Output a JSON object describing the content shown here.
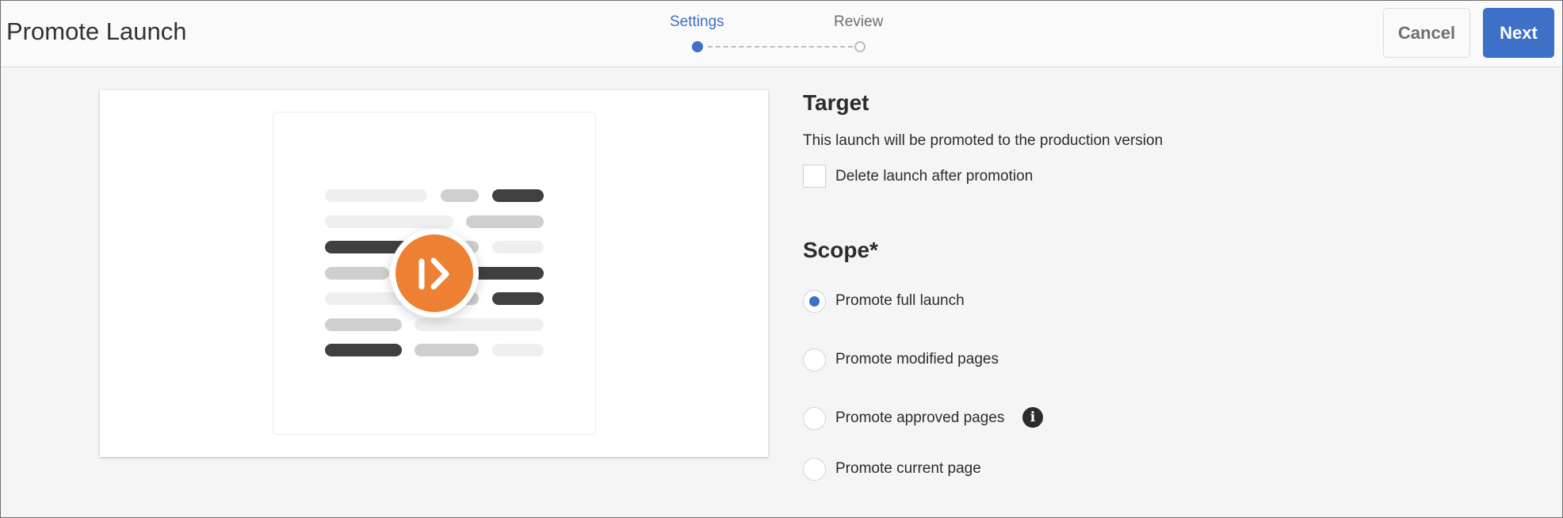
{
  "header": {
    "title": "Promote Launch",
    "steps": [
      {
        "label": "Settings",
        "state": "active"
      },
      {
        "label": "Review",
        "state": "pending"
      }
    ],
    "cancel_label": "Cancel",
    "next_label": "Next"
  },
  "colors": {
    "accent": "#3d70c6",
    "badge": "#ee8033"
  },
  "illustration": {
    "icon": "promote-launch-icon"
  },
  "target": {
    "heading": "Target",
    "description": "This launch will be promoted to the production version",
    "delete_checkbox_label": "Delete launch after promotion",
    "delete_checked": false
  },
  "scope": {
    "heading": "Scope*",
    "options": [
      {
        "label": "Promote full launch",
        "selected": true
      },
      {
        "label": "Promote modified pages",
        "selected": false
      },
      {
        "label": "Promote approved pages",
        "selected": false,
        "info_icon": "info-icon"
      },
      {
        "label": "Promote current page",
        "selected": false
      }
    ]
  }
}
